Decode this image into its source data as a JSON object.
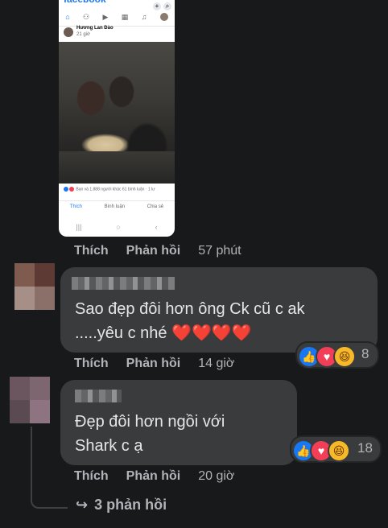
{
  "post_screenshot": {
    "logo": "facebook",
    "author": "Hương Lan Đào",
    "time": "21 giờ",
    "reactions_summary": "Bạn và 1.888 người khác  61 bình luận · 1 lư",
    "actions": {
      "like": "Thích",
      "comment": "Bình luận",
      "share": "Chia sẻ"
    }
  },
  "top_comment_actions": {
    "like": "Thích",
    "reply": "Phản hồi",
    "time": "57 phút"
  },
  "comments": [
    {
      "author": "",
      "lines": [
        "Sao đẹp đôi hơn ông Ck cũ c ak",
        ".....yêu c nhé ❤️❤️❤️❤️"
      ],
      "reaction_count": "8",
      "like": "Thích",
      "reply": "Phản hồi",
      "time": "14 giờ"
    },
    {
      "author": "",
      "lines": [
        "Đẹp đôi hơn ngồi với",
        "Shark c ạ"
      ],
      "reaction_count": "18",
      "like": "Thích",
      "reply": "Phản hồi",
      "time": "20 giờ"
    }
  ],
  "view_replies": "3 phản hồi",
  "colors": {
    "background": "#18191a",
    "bubble": "#3a3b3c",
    "secondary_text": "#b0b3b8",
    "like_blue": "#1877f2",
    "love_red": "#f33e58",
    "haha_yellow": "#f7b928"
  },
  "icons": [
    "home-icon",
    "friends-icon",
    "video-icon",
    "marketplace-icon",
    "bell-icon",
    "like-reaction-icon",
    "love-reaction-icon",
    "haha-reaction-icon",
    "reply-arrow-icon"
  ]
}
